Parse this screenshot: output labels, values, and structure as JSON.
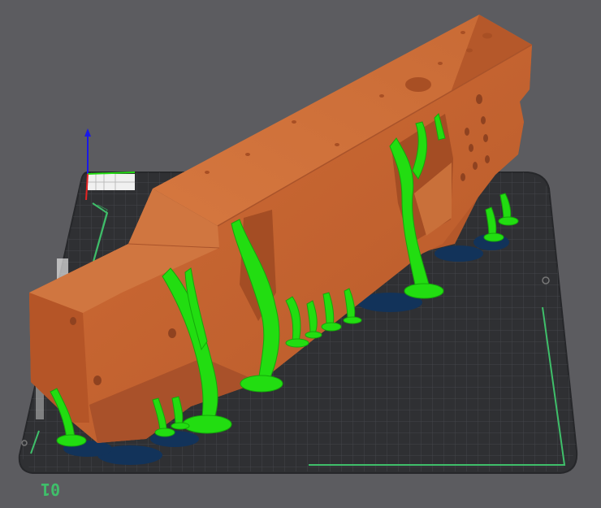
{
  "scene": {
    "bed_number": "01",
    "colors": {
      "background": "#5c5c60",
      "bed": "#2f3033",
      "bed_grid": "#45474b",
      "bed_outline": "#3fbf6a",
      "model_face": "#c3622e",
      "model_top": "#d77a44",
      "model_shadow": "#9b4a22",
      "supports": "#22dd11",
      "support_base": "#12335a"
    }
  }
}
